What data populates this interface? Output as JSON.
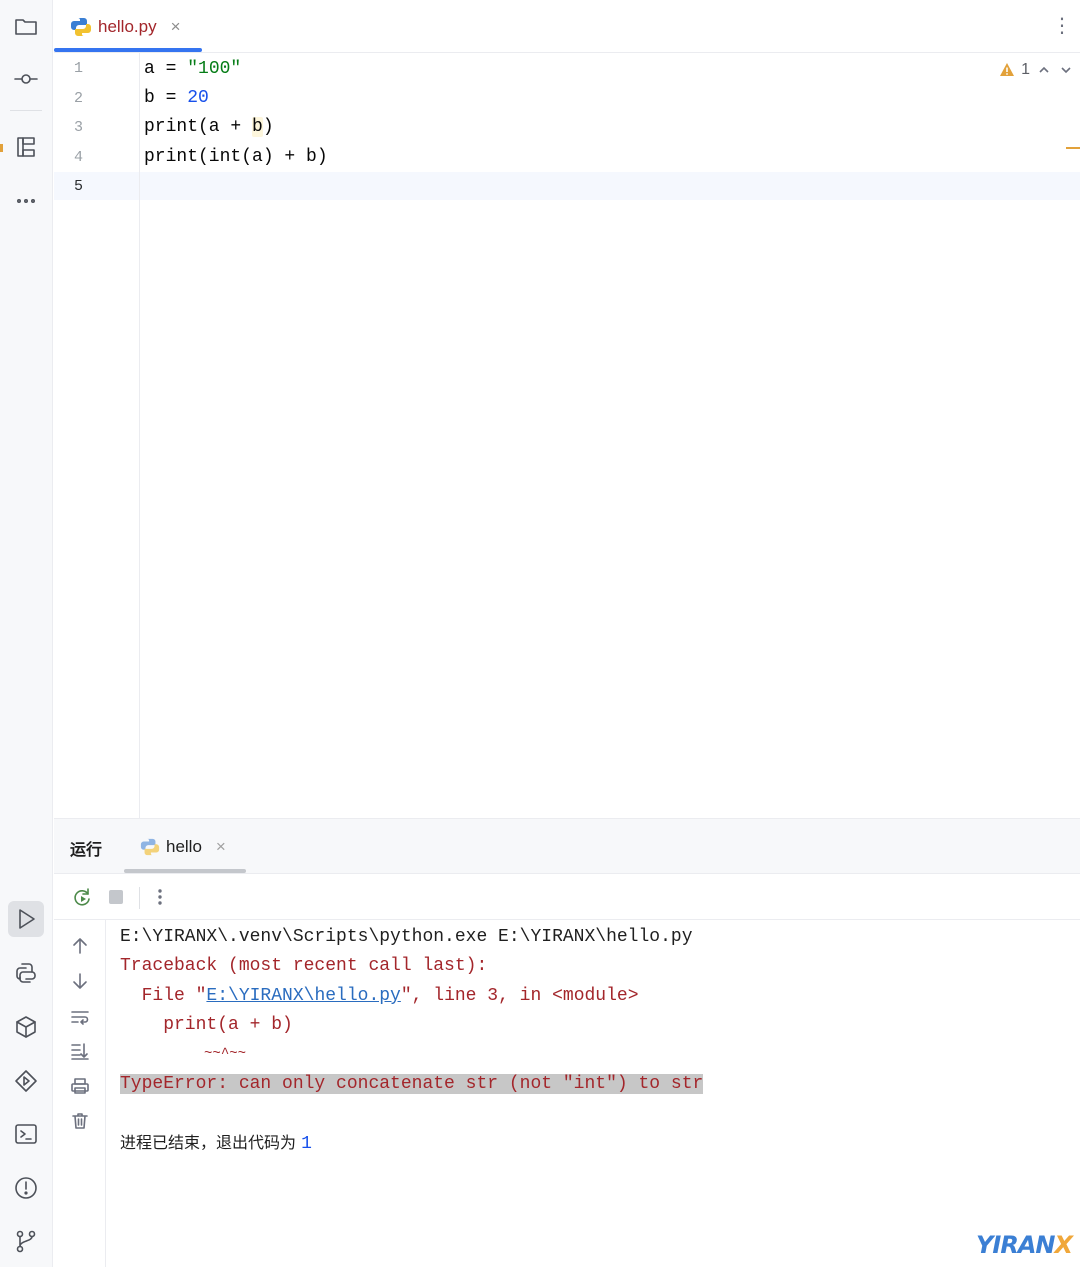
{
  "editor": {
    "tab": {
      "label": "hello.py",
      "close": "×",
      "icon": "python-file-icon"
    },
    "more_label": "⋮",
    "line_numbers": [
      "1",
      "2",
      "3",
      "4",
      "5"
    ],
    "code": {
      "line1": {
        "p1": "a = ",
        "p2": "\"100\""
      },
      "line2": {
        "p1": "b = ",
        "p2": "20"
      },
      "line3": {
        "p1": "print(a + ",
        "p2": "b",
        "p3": ")"
      },
      "line4": {
        "p1": "print(int(a) + b)"
      }
    },
    "inspection": {
      "warning_count": "1",
      "icon": "warning-icon"
    }
  },
  "run": {
    "title": "运行",
    "tab": {
      "label": "hello",
      "close": "×",
      "icon": "python-run-config-icon"
    }
  },
  "console": {
    "line1": "E:\\YIRANX\\.venv\\Scripts\\python.exe E:\\YIRANX\\hello.py",
    "line2": "Traceback (most recent call last):",
    "line3": {
      "pre": "  File \"",
      "link": "E:\\YIRANX\\hello.py",
      "post": "\", line 3, in <module>"
    },
    "line4": "    print(a + b)",
    "line5": "          ~~^~~",
    "line6": "TypeError: can only concatenate str (not \"int\") to str",
    "exit": {
      "text": "进程已结束，退出代码为 ",
      "code": "1"
    }
  },
  "watermark": {
    "part1": "YIRAN",
    "part2": "X"
  },
  "colors": {
    "accent": "#3574f0",
    "error_text": "#a3262b",
    "string": "#067d17",
    "number": "#1750eb",
    "warning": "#e2a13a",
    "link": "#2a6cbf"
  }
}
